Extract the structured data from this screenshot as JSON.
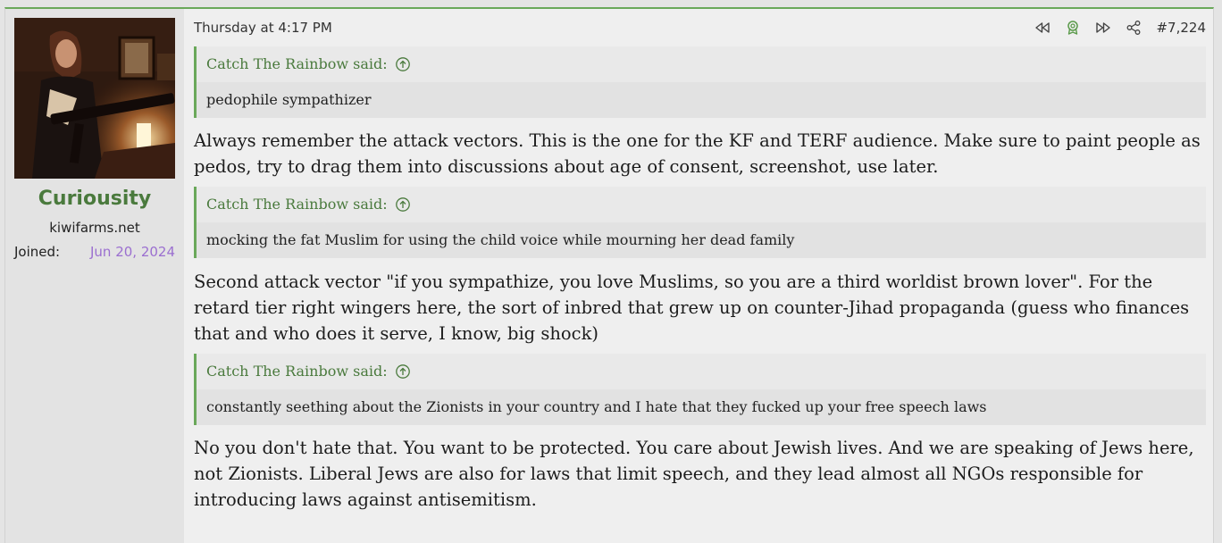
{
  "user": {
    "name": "Curiousity",
    "title": "kiwifarms.net",
    "joined_label": "Joined:",
    "joined_value": "Jun 20, 2024"
  },
  "header": {
    "timestamp": "Thursday at 4:17 PM",
    "post_number": "#7,224",
    "icons": [
      "rewind-icon",
      "award-icon",
      "fast-forward-icon",
      "share-icon"
    ]
  },
  "colors": {
    "accent_green": "#4a7a3d",
    "quote_border": "#6aa85a",
    "joined_purple": "#9b6fd0"
  },
  "content": {
    "quote1": {
      "author": "Catch The Rainbow said:",
      "text": "pedophile sympathizer"
    },
    "para1": "Always remember the attack vectors. This is the one for the KF and TERF audience. Make sure to paint people as pedos, try to drag them into discussions about age of consent, screenshot, use later.",
    "quote2": {
      "author": "Catch The Rainbow said:",
      "text": "mocking the fat Muslim for using the child voice while mourning her dead family"
    },
    "para2": "Second attack vector \"if you sympathize, you love Muslims, so you are a third worldist brown lover\". For the retard tier right wingers here, the sort of inbred that grew up on counter-Jihad propaganda (guess who finances that and who does it serve, I know, big shock)",
    "quote3": {
      "author": "Catch The Rainbow said:",
      "text": "constantly seething about the Zionists in your country and I hate that they fucked up your free speech laws"
    },
    "para3": "No you don't hate that. You want to be protected. You care about Jewish lives. And we are speaking of Jews here, not Zionists. Liberal Jews are also for laws that limit speech, and they lead almost all NGOs responsible for introducing laws against antisemitism."
  }
}
